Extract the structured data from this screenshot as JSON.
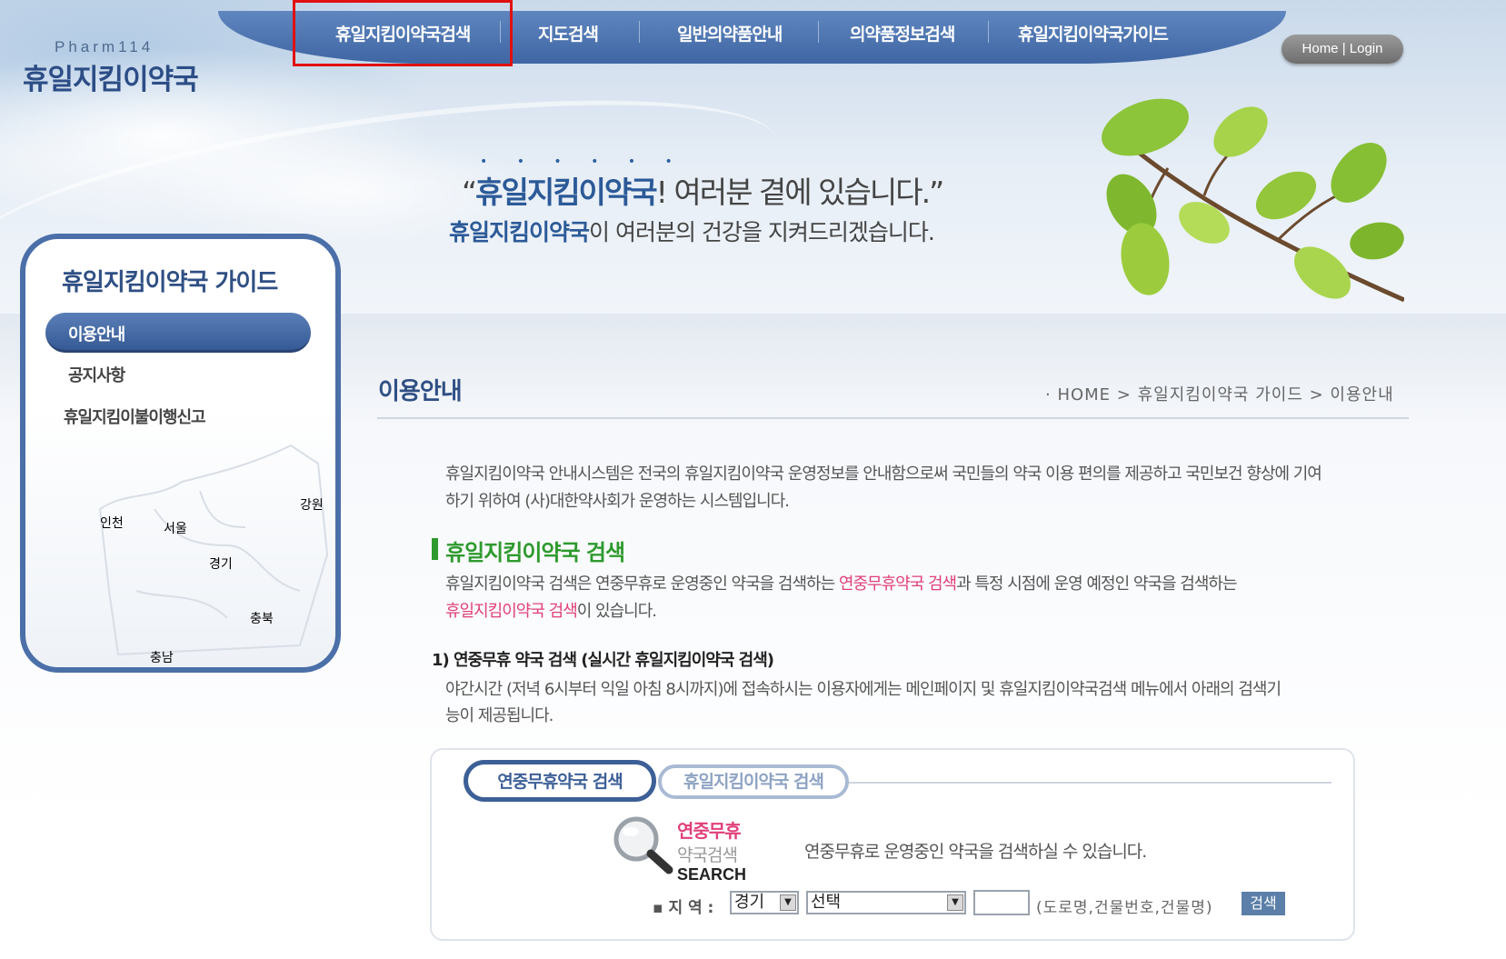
{
  "logo": {
    "top": "Pharm114",
    "main": "휴일지킴이약국"
  },
  "nav": {
    "items": [
      "휴일지킴이약국검색",
      "지도검색",
      "일반의약품안내",
      "의약품정보검색",
      "휴일지킴이약국가이드"
    ],
    "home_login": "Home | Login"
  },
  "slogan": {
    "dots": "• • • • • •",
    "line1_open": "“",
    "line1_bold": "휴일지킴이약국",
    "line1_rest": "! 여러분 곁에 있습니다.”",
    "line2_bold": "휴일지킴이약국",
    "line2_rest": "이 여러분의 건강을 지켜드리겠습니다."
  },
  "sidebar": {
    "title": "휴일지킴이약국 가이드",
    "items": [
      "이용안내",
      "공지사항",
      "휴일지킴이불이행신고"
    ],
    "map_labels": [
      "인천",
      "서울",
      "경기",
      "강원",
      "충북",
      "충남"
    ]
  },
  "content": {
    "page_title": "이용안내",
    "breadcrumb": "· HOME > 휴일지킴이약국 가이드 > 이용안내",
    "intro_line1": "휴일지킴이약국 안내시스템은 전국의 휴일지킴이약국 운영정보를 안내함으로써 국민들의 약국 이용 편의를 제공하고 국민보건 향상에 기여",
    "intro_line2": "하기 위하여 (사)대한약사회가 운영하는 시스템입니다.",
    "section_title": "휴일지킴이약국 검색",
    "section_p1_a": "휴일지킴이약국 검색은 연중무휴로 운영중인 약국을 검색하는 ",
    "section_p1_pink": "연중무휴약국 검색",
    "section_p1_b": "과 특정 시점에 운영 예정인 약국을 검색하는",
    "section_p2_pink": "휴일지킴이약국 검색",
    "section_p2_b": "이 있습니다.",
    "sub_title": "1) 연중무휴 약국 검색 (실시간 휴일지킴이약국 검색)",
    "sub_line1": "야간시간 (저녁 6시부터 익일 아침 8시까지)에 접속하시는 이용자에게는 메인페이지 및 휴일지킴이약국검색 메뉴에서 아래의 검색기",
    "sub_line2": "능이 제공됩니다."
  },
  "search": {
    "tabs": [
      "연중무휴약국 검색",
      "휴일지킴이약국 검색"
    ],
    "label_red": "연중무휴",
    "label_gray": "약국검색",
    "label_en": "SEARCH",
    "description": "연중무휴로 운영중인 약국을 검색하실 수 있습니다.",
    "region_label": "▪ 지 역 :",
    "region_value": "경기",
    "district_value": "선택",
    "address_value": "",
    "address_hint": "(도로명,건물번호,건물명)",
    "button": "검색"
  },
  "colors": {
    "nav": "#4a71ad",
    "highlight_box": "#e01010",
    "accent_pink": "#e0407a",
    "section_green": "#2e9a2e"
  }
}
